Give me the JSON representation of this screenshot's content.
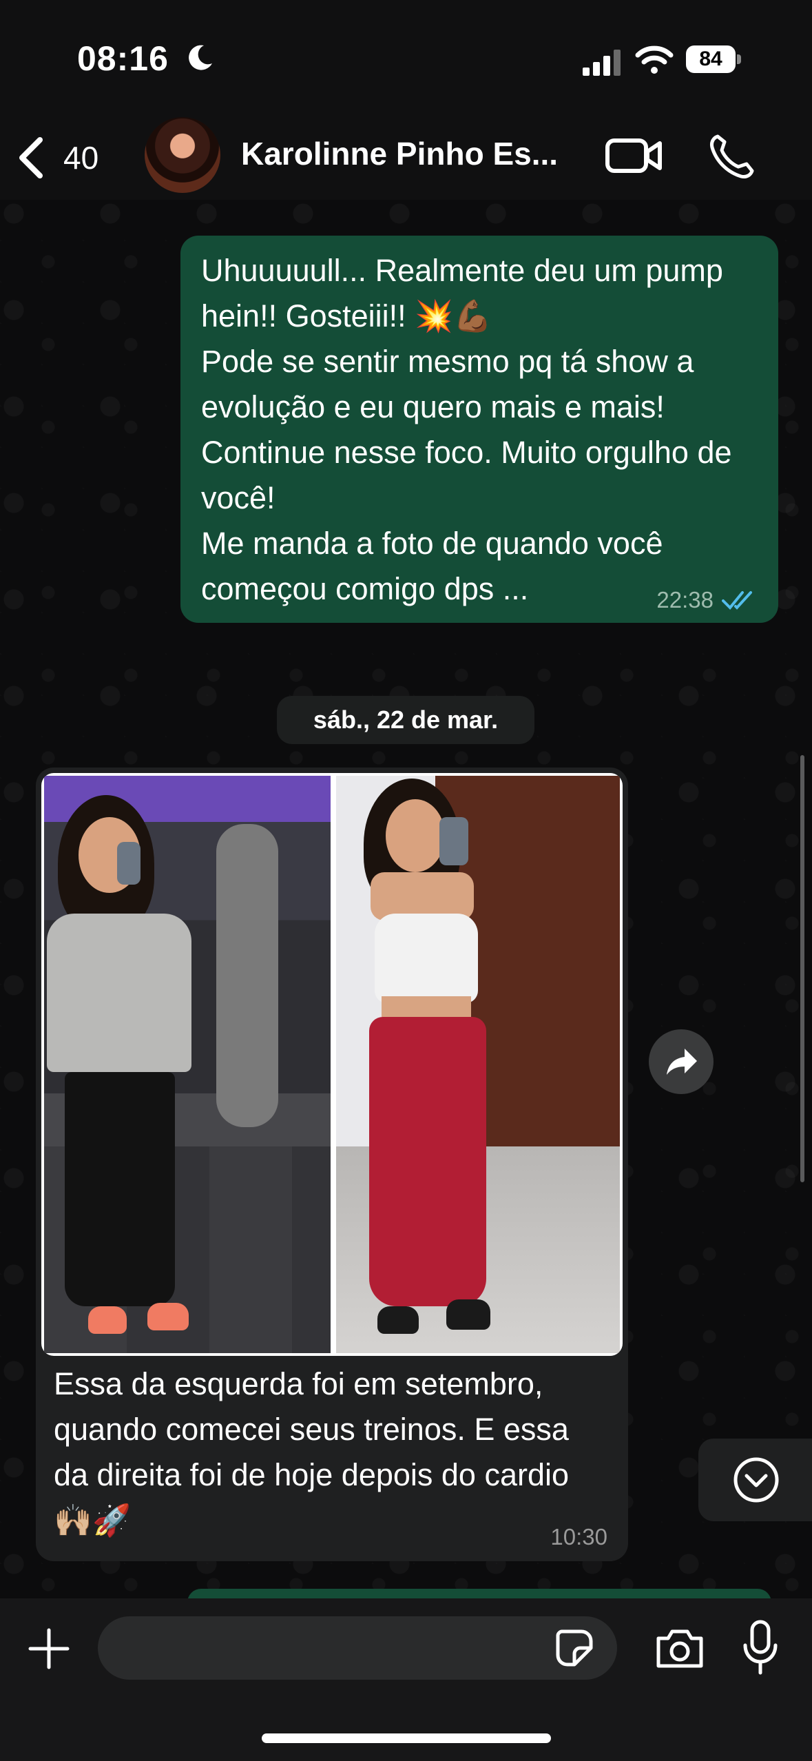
{
  "status_bar": {
    "time": "08:16",
    "battery": "84"
  },
  "header": {
    "back_count": "40",
    "contact_name": "Karolinne Pinho Es..."
  },
  "messages": {
    "outgoing": {
      "text": "Uhuuuuull... Realmente deu um pump hein!! Gosteiii!! 💥💪🏾\nPode se sentir mesmo pq tá show a evolução e eu quero mais e mais! Continue nesse foco. Muito orgulho de você!\nMe manda a foto de quando você começou comigo dps ...",
      "time": "22:38"
    },
    "date_separator": "sáb., 22 de mar.",
    "incoming": {
      "caption": "Essa da esquerda foi em setembro, quando comecei seus treinos. E essa da direita foi de hoje depois do cardio 🙌🏼🚀",
      "time": "10:30"
    }
  },
  "input": {
    "placeholder": ""
  },
  "colors": {
    "outgoing_bubble": "#144d37",
    "incoming_bubble": "#1f2021",
    "read_ticks": "#53bdeb",
    "background": "#0b0b0c"
  },
  "icons": [
    "moon-icon",
    "signal-icon",
    "wifi-icon",
    "battery-icon",
    "back-chevron-icon",
    "video-call-icon",
    "phone-icon",
    "read-ticks-icon",
    "forward-icon",
    "chevron-down-icon",
    "plus-icon",
    "sticker-icon",
    "camera-icon",
    "mic-icon"
  ]
}
